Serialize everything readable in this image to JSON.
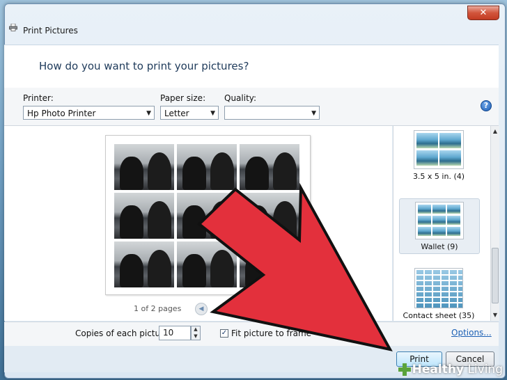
{
  "window": {
    "title": "Print Pictures",
    "close_label": "✕"
  },
  "header": {
    "question": "How do you want to print your pictures?"
  },
  "options": {
    "printer": {
      "label": "Printer:",
      "value": "Hp Photo Printer"
    },
    "paper_size": {
      "label": "Paper size:",
      "value": "Letter"
    },
    "quality": {
      "label": "Quality:",
      "value": ""
    },
    "help": "?"
  },
  "preview": {
    "page_status": "1 of 2 pages",
    "prev_symbol": "◀"
  },
  "layouts": [
    {
      "caption": "3.5 x 5 in. (4)"
    },
    {
      "caption": "Wallet (9)"
    },
    {
      "caption": "Contact sheet (35)"
    }
  ],
  "footer": {
    "copies_label": "Copies of each picture:",
    "copies_value": "10",
    "fit_label": "Fit picture to frame",
    "options_link": "Options..."
  },
  "buttons": {
    "print": "Print",
    "cancel": "Cancel"
  },
  "watermark": {
    "brand": "Healthy",
    "brand_rest": " Living"
  },
  "colors": {
    "arrow_fill": "#e3303c",
    "accent_link": "#1a5fb4"
  }
}
